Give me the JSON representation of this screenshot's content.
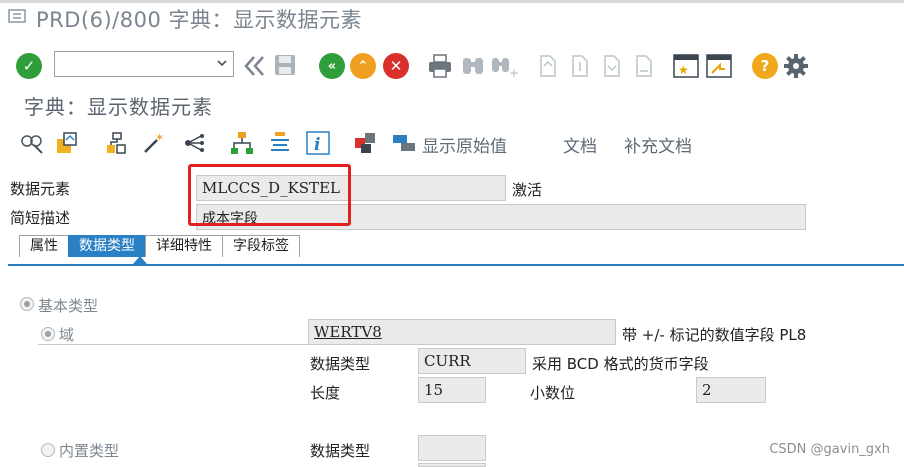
{
  "window": {
    "title": "PRD(6)/800 字典：显示数据元素"
  },
  "toolbar": {
    "command_value": ""
  },
  "page": {
    "title": "字典：显示数据元素"
  },
  "app_toolbar": {
    "show_original_value": "显示原始值",
    "documentation": "文档",
    "supplementary_documentation": "补充文档"
  },
  "fields": {
    "data_element": {
      "label": "数据元素",
      "value": "MLCCS_D_KSTEL",
      "status": "激活"
    },
    "short_description": {
      "label": "简短描述",
      "value": "成本字段"
    }
  },
  "tabs": [
    {
      "label": "属性",
      "active": false
    },
    {
      "label": "数据类型",
      "active": true
    },
    {
      "label": "详细特性",
      "active": false
    },
    {
      "label": "字段标签",
      "active": false
    }
  ],
  "data_type": {
    "elementary_type_label": "基本类型",
    "domain": {
      "label": "域",
      "value": "WERTV8",
      "description": "带 +/- 标记的数值字段 PL8",
      "data_type_label": "数据类型",
      "data_type_value": "CURR",
      "data_type_description": "采用 BCD 格式的货币字段",
      "length_label": "长度",
      "length_value": "15",
      "decimals_label": "小数位",
      "decimals_value": "2"
    },
    "builtin": {
      "label": "内置类型",
      "data_type_label": "数据类型",
      "data_type_value": ""
    }
  },
  "watermark": "CSDN @gavin_gxh",
  "colors": {
    "accent": "#2a80c4",
    "highlight_box": "#e0201e",
    "ok_green": "#2e9e3a",
    "back_green": "#2e9e3a",
    "exit_orange": "#f0a020",
    "cancel_red": "#d9302b",
    "help_yellow": "#f0a81c"
  }
}
